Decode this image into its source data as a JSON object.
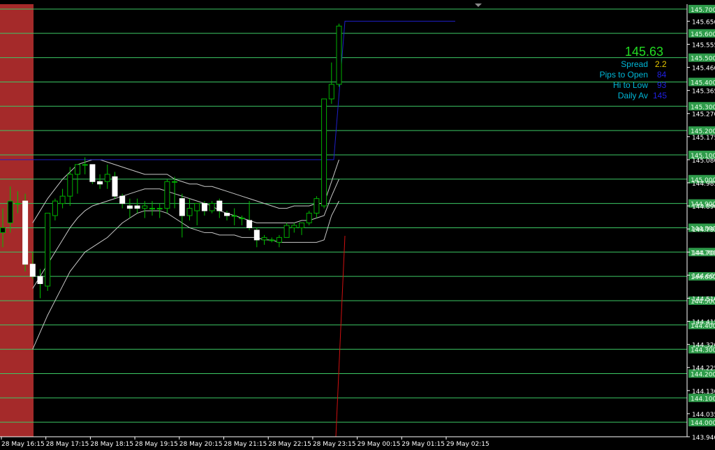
{
  "colors": {
    "background": "#000000",
    "bull_candle": "#00b000",
    "bear_candle": "#ffffff",
    "wick": "#00c000",
    "grid_level": "#3cc864",
    "level_label_bg": "#2e9b4a",
    "bands": "#c8c8c8",
    "blue_line": "#1f1fc8",
    "red_line": "#d01010",
    "red_zone": "#a52a2a",
    "axis": "#ffffff"
  },
  "info_panel": {
    "price": "145.63",
    "price_color": "#22dd22",
    "rows": [
      {
        "label": "Spread",
        "value": "2.2",
        "label_color": "#00b8d8",
        "value_color": "#e8c800"
      },
      {
        "label": "Pips to Open",
        "value": "84",
        "label_color": "#00b8d8",
        "value_color": "#2020e0"
      },
      {
        "label": "Hi to Low",
        "value": "93",
        "label_color": "#00b8d8",
        "value_color": "#2020e0"
      },
      {
        "label": "Daily Av",
        "value": "145",
        "label_color": "#00b8d8",
        "value_color": "#2020e0"
      }
    ]
  },
  "chart_data": {
    "type": "candlestick",
    "ylim": [
      143.94,
      145.72
    ],
    "y_tick_labels": [
      "145.650",
      "145.555",
      "145.460",
      "145.365",
      "145.270",
      "145.175",
      "145.080",
      "144.985",
      "144.890",
      "144.795",
      "144.700",
      "144.605",
      "144.510",
      "144.415",
      "144.320",
      "144.225",
      "144.130",
      "144.035",
      "143.940"
    ],
    "y_tick_values": [
      145.65,
      145.555,
      145.46,
      145.365,
      145.27,
      145.175,
      145.08,
      144.985,
      144.89,
      144.795,
      144.7,
      144.605,
      144.51,
      144.415,
      144.32,
      144.225,
      144.13,
      144.035,
      143.94
    ],
    "level_labels": [
      "145.700",
      "145.600",
      "145.500",
      "145.400",
      "145.300",
      "145.200",
      "145.100",
      "145.000",
      "144.900",
      "144.800",
      "144.700",
      "144.600",
      "144.500",
      "144.400",
      "144.300",
      "144.200",
      "144.100",
      "144.000"
    ],
    "level_values": [
      145.7,
      145.6,
      145.5,
      145.4,
      145.3,
      145.2,
      145.1,
      145.0,
      144.9,
      144.8,
      144.7,
      144.6,
      144.5,
      144.4,
      144.3,
      144.2,
      144.1,
      144.0
    ],
    "x_labels": [
      "28 May 16:15",
      "28 May 17:15",
      "28 May 18:15",
      "28 May 19:15",
      "28 May 20:15",
      "28 May 21:15",
      "28 May 22:15",
      "28 May 23:15",
      "29 May 00:15",
      "29 May 01:15",
      "29 May 02:15"
    ],
    "candles": [
      {
        "o": 144.78,
        "h": 144.88,
        "l": 144.72,
        "c": 144.8
      },
      {
        "o": 144.82,
        "h": 144.97,
        "l": 144.78,
        "c": 144.91
      },
      {
        "o": 144.9,
        "h": 144.95,
        "l": 144.86,
        "c": 144.9
      },
      {
        "o": 144.91,
        "h": 144.94,
        "l": 144.62,
        "c": 144.65
      },
      {
        "o": 144.65,
        "h": 144.7,
        "l": 144.59,
        "c": 144.6
      },
      {
        "o": 144.6,
        "h": 144.63,
        "l": 144.51,
        "c": 144.57
      },
      {
        "o": 144.56,
        "h": 144.79,
        "l": 144.54,
        "c": 144.86
      },
      {
        "o": 144.85,
        "h": 144.92,
        "l": 144.83,
        "c": 144.91
      },
      {
        "o": 144.9,
        "h": 144.96,
        "l": 144.88,
        "c": 144.93
      },
      {
        "o": 144.93,
        "h": 145.05,
        "l": 144.89,
        "c": 145.02
      },
      {
        "o": 145.02,
        "h": 145.05,
        "l": 144.94,
        "c": 145.06
      },
      {
        "o": 145.06,
        "h": 145.09,
        "l": 145.02,
        "c": 145.06
      },
      {
        "o": 145.06,
        "h": 145.06,
        "l": 144.98,
        "c": 144.99
      },
      {
        "o": 144.99,
        "h": 145.02,
        "l": 144.96,
        "c": 144.98
      },
      {
        "o": 144.99,
        "h": 145.06,
        "l": 144.96,
        "c": 145.02
      },
      {
        "o": 145.01,
        "h": 145.03,
        "l": 144.92,
        "c": 144.93
      },
      {
        "o": 144.93,
        "h": 144.94,
        "l": 144.88,
        "c": 144.9
      },
      {
        "o": 144.89,
        "h": 144.92,
        "l": 144.84,
        "c": 144.88
      },
      {
        "o": 144.89,
        "h": 144.92,
        "l": 144.86,
        "c": 144.88
      },
      {
        "o": 144.88,
        "h": 144.91,
        "l": 144.84,
        "c": 144.89
      },
      {
        "o": 144.88,
        "h": 144.91,
        "l": 144.85,
        "c": 144.88
      },
      {
        "o": 144.88,
        "h": 144.9,
        "l": 144.84,
        "c": 144.88
      },
      {
        "o": 144.88,
        "h": 145.0,
        "l": 144.86,
        "c": 144.99
      },
      {
        "o": 144.99,
        "h": 145.01,
        "l": 144.88,
        "c": 144.99
      },
      {
        "o": 144.92,
        "h": 144.94,
        "l": 144.76,
        "c": 144.85
      },
      {
        "o": 144.85,
        "h": 144.92,
        "l": 144.83,
        "c": 144.88
      },
      {
        "o": 144.87,
        "h": 144.9,
        "l": 144.81,
        "c": 144.9
      },
      {
        "o": 144.9,
        "h": 144.91,
        "l": 144.85,
        "c": 144.87
      },
      {
        "o": 144.87,
        "h": 144.91,
        "l": 144.86,
        "c": 144.9
      },
      {
        "o": 144.91,
        "h": 144.92,
        "l": 144.84,
        "c": 144.87
      },
      {
        "o": 144.86,
        "h": 144.87,
        "l": 144.83,
        "c": 144.85
      },
      {
        "o": 144.85,
        "h": 144.88,
        "l": 144.81,
        "c": 144.85
      },
      {
        "o": 144.84,
        "h": 144.85,
        "l": 144.81,
        "c": 144.84
      },
      {
        "o": 144.83,
        "h": 144.91,
        "l": 144.79,
        "c": 144.8
      },
      {
        "o": 144.79,
        "h": 144.8,
        "l": 144.72,
        "c": 144.75
      },
      {
        "o": 144.75,
        "h": 144.77,
        "l": 144.73,
        "c": 144.76
      },
      {
        "o": 144.75,
        "h": 144.76,
        "l": 144.74,
        "c": 144.75
      },
      {
        "o": 144.74,
        "h": 144.77,
        "l": 144.72,
        "c": 144.76
      },
      {
        "o": 144.76,
        "h": 144.82,
        "l": 144.79,
        "c": 144.81
      },
      {
        "o": 144.8,
        "h": 144.82,
        "l": 144.78,
        "c": 144.81
      },
      {
        "o": 144.8,
        "h": 144.81,
        "l": 144.77,
        "c": 144.82
      },
      {
        "o": 144.82,
        "h": 144.87,
        "l": 144.81,
        "c": 144.86
      },
      {
        "o": 144.86,
        "h": 144.93,
        "l": 144.84,
        "c": 144.92
      },
      {
        "o": 144.89,
        "h": 145.31,
        "l": 144.88,
        "c": 145.33
      },
      {
        "o": 145.33,
        "h": 145.48,
        "l": 145.31,
        "c": 145.39
      },
      {
        "o": 145.39,
        "h": 145.64,
        "l": 145.38,
        "c": 145.63
      }
    ],
    "band_upper": [
      144.82,
      144.87,
      144.92,
      144.96,
      145.0,
      145.03,
      145.06,
      145.07,
      145.08,
      145.08,
      145.07,
      145.06,
      145.05,
      145.04,
      145.03,
      145.02,
      145.02,
      145.02,
      145.02,
      145.0,
      144.99,
      144.98,
      144.98,
      144.97,
      144.97,
      144.96,
      144.95,
      144.94,
      144.93,
      144.92,
      144.91,
      144.9,
      144.89,
      144.88,
      144.88,
      144.89,
      144.89,
      144.89,
      144.9,
      144.9,
      144.99,
      145.08
    ],
    "band_middle": [
      144.55,
      144.6,
      144.65,
      144.7,
      144.75,
      144.8,
      144.84,
      144.87,
      144.89,
      144.9,
      144.91,
      144.92,
      144.93,
      144.94,
      144.95,
      144.96,
      144.96,
      144.96,
      144.95,
      144.94,
      144.93,
      144.92,
      144.91,
      144.9,
      144.89,
      144.87,
      144.86,
      144.85,
      144.84,
      144.83,
      144.82,
      144.82,
      144.82,
      144.82,
      144.82,
      144.82,
      144.83,
      144.83,
      144.84,
      144.85,
      144.93,
      145.0
    ],
    "band_lower": [
      144.3,
      144.37,
      144.44,
      144.5,
      144.56,
      144.62,
      144.66,
      144.7,
      144.72,
      144.74,
      144.76,
      144.79,
      144.82,
      144.84,
      144.86,
      144.87,
      144.87,
      144.87,
      144.86,
      144.84,
      144.82,
      144.8,
      144.79,
      144.78,
      144.78,
      144.77,
      144.77,
      144.77,
      144.76,
      144.76,
      144.76,
      144.75,
      144.75,
      144.74,
      144.74,
      144.74,
      144.74,
      144.74,
      144.74,
      144.75,
      144.85,
      144.91
    ],
    "blue_line_low": 145.08,
    "blue_line_high": 145.65,
    "grid": false,
    "legend": "none"
  }
}
